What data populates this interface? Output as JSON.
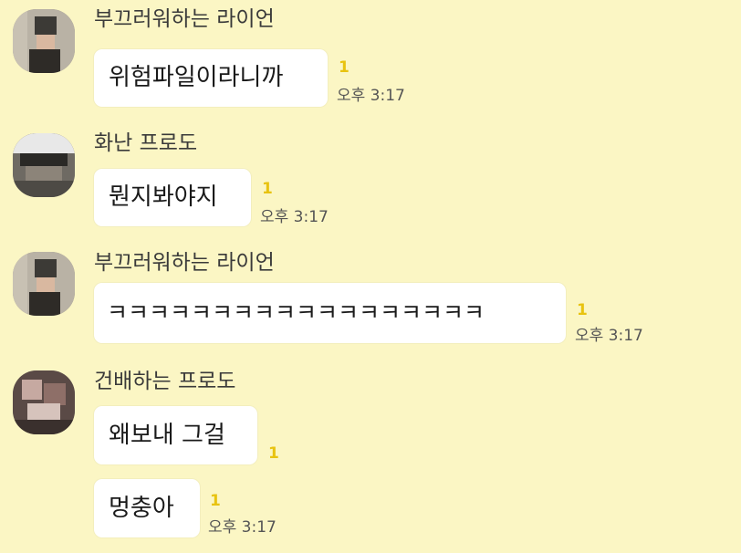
{
  "colors": {
    "background": "#fbf6c4",
    "bubble": "#ffffff",
    "unread_count": "#e8c310",
    "sender_text": "#3a3a3a",
    "time_text": "#555555"
  },
  "messages": [
    {
      "sender": "부끄러워하는 라이언",
      "text": "위험파일이라니까",
      "unread": "1",
      "time": "오후 3:17"
    },
    {
      "sender": "화난 프로도",
      "text": "뭔지봐야지",
      "unread": "1",
      "time": "오후 3:17"
    },
    {
      "sender": "부끄러워하는 라이언",
      "text": "ㅋㅋㅋㅋㅋㅋㅋㅋㅋㅋㅋㅋㅋㅋㅋㅋㅋㅋ",
      "unread": "1",
      "time": "오후 3:17"
    },
    {
      "sender": "건배하는 프로도",
      "text": "왜보내 그걸",
      "unread": "1",
      "time": ""
    },
    {
      "sender": "",
      "text": "멍충아",
      "unread": "1",
      "time": "오후 3:17"
    }
  ]
}
